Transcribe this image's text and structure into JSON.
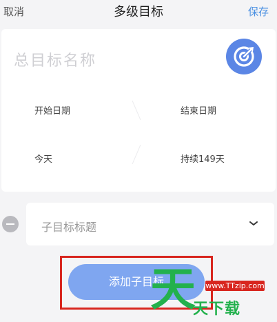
{
  "nav": {
    "cancel": "取消",
    "title": "多级目标",
    "save": "保存"
  },
  "goal": {
    "placeholder": "总目标名称",
    "icon": "target-icon"
  },
  "dates": {
    "start_label": "开始日期",
    "end_label": "结束日期",
    "start_value": "今天",
    "end_value": "持续149天"
  },
  "subgoal": {
    "placeholder": "子目标标题",
    "remove_icon": "minus-circle-icon",
    "expand_icon": "chevron-down-icon"
  },
  "add_button": "添加子目标",
  "watermark": {
    "big": "天",
    "url": "www.TTzip.com",
    "small": "天下载"
  },
  "colors": {
    "accent": "#4a90e2",
    "button": "#7fa6f0",
    "highlight": "#d8261f",
    "watermark_green": "#23b14d"
  }
}
